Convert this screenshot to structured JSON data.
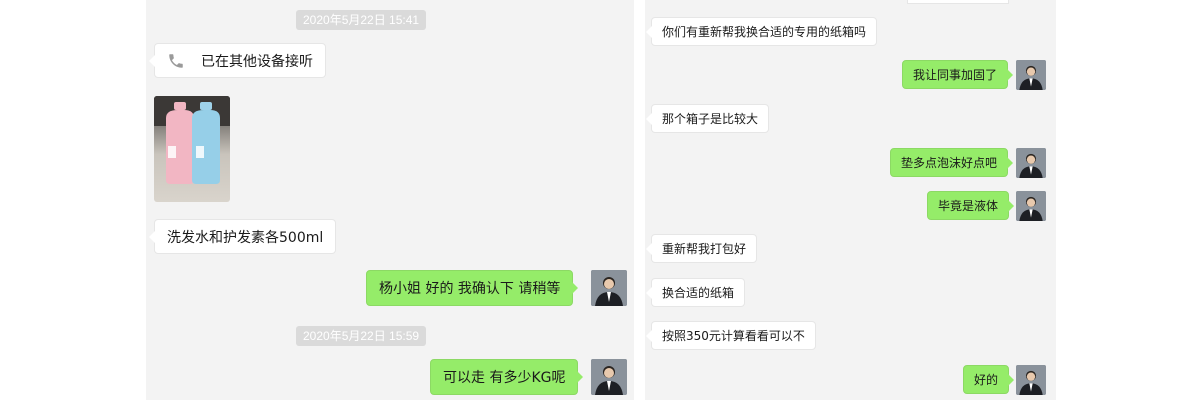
{
  "left": {
    "timestamp_1": "2020年5月22日 15:41",
    "call_message": {
      "icon": "phone-icon",
      "text": "已在其他设备接听"
    },
    "photo": {
      "description_icon": "shampoo-bottles-photo"
    },
    "message_1": "洗发水和护发素各500ml",
    "reply_1": "杨小姐 好的 我确认下 请稍等",
    "timestamp_2": "2020年5月22日 15:59",
    "reply_2": "可以走 有多少KG呢"
  },
  "right": {
    "messages": [
      {
        "side": "in",
        "text": "你们有重新帮我换合适的专用的纸箱吗"
      },
      {
        "side": "out",
        "text": "我让同事加固了"
      },
      {
        "side": "in",
        "text": "那个箱子是比较大"
      },
      {
        "side": "out",
        "text": "垫多点泡沫好点吧"
      },
      {
        "side": "out",
        "text": "毕竟是液体"
      },
      {
        "side": "in",
        "text": "重新帮我打包好"
      },
      {
        "side": "in",
        "text": "换合适的纸箱"
      },
      {
        "side": "in",
        "text": "按照350元计算看看可以不"
      },
      {
        "side": "out",
        "text": "好的"
      }
    ]
  },
  "colors": {
    "outgoing_bubble": "#95ec69",
    "incoming_bubble": "#ffffff",
    "chat_background": "#f3f3f3",
    "timestamp_bg": "#dadada"
  }
}
